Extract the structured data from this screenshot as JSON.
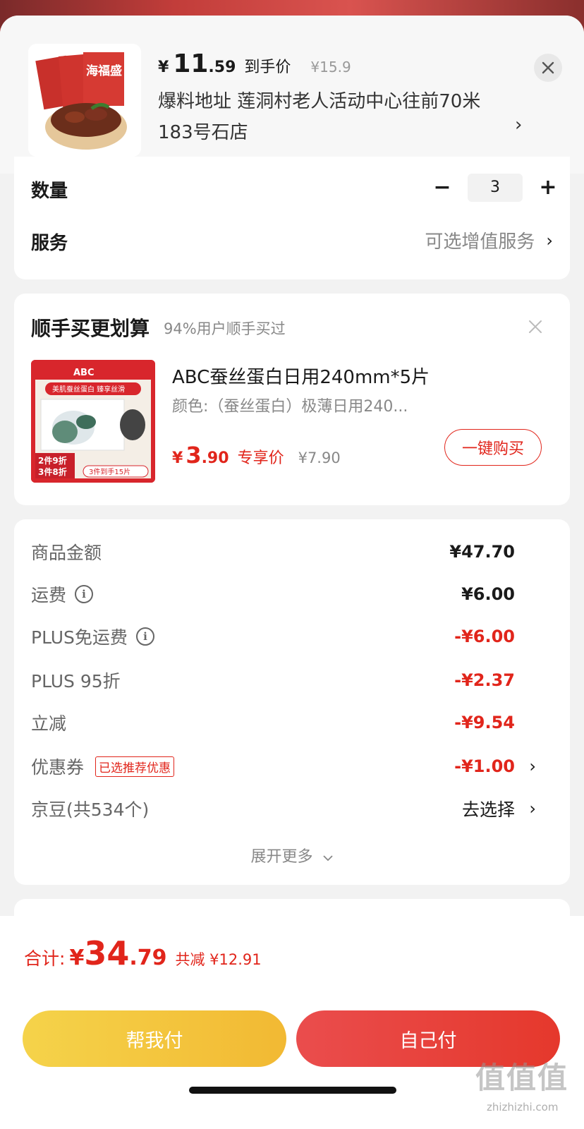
{
  "header": {
    "price_currency": "¥",
    "price_int": "11",
    "price_dec": ".59",
    "price_tag": "到手价",
    "original_price": "¥15.9",
    "address": "爆料地址  莲洞村老人活动中心往前70米183号石店",
    "address_chevron": "›",
    "close_icon": "close-icon",
    "product_image_text": "海福盛"
  },
  "quantity": {
    "label": "数量",
    "minus": "−",
    "value": "3",
    "plus": "+"
  },
  "service": {
    "label": "服务",
    "value": "可选增值服务",
    "chevron": "›"
  },
  "upsell": {
    "title": "顺手买更划算",
    "subtitle": "94%用户顺手买过",
    "item": {
      "name": "ABC蚕丝蛋白日用240mm*5片",
      "color": "颜色:（蚕丝蛋白）极薄日用240...",
      "price_currency": "¥",
      "price_int": "3",
      "price_dec": ".90",
      "price_tag": "专享价",
      "original_price": "¥7.90",
      "buy_label": "一键购买",
      "image_brand": "ABC",
      "image_line1": "美肌蚕丝蛋白 臻享丝滑",
      "image_badge1": "2件9折",
      "image_badge2": "3件8折",
      "image_badge3": "3件到手15片"
    }
  },
  "summary": {
    "rows": [
      {
        "label": "商品金额",
        "value": "¥47.70"
      },
      {
        "label": "运费",
        "value": "¥6.00"
      },
      {
        "label": "PLUS免运费",
        "value": "-¥6.00"
      },
      {
        "label": "PLUS 95折",
        "value": "-¥2.37"
      },
      {
        "label": "立减",
        "value": "-¥9.54"
      },
      {
        "label": "优惠券",
        "tag": "已选推荐优惠",
        "value": "-¥1.00"
      },
      {
        "label": "京豆(共534个)",
        "value": "去选择"
      }
    ],
    "expand_label": "展开更多",
    "expand_icon": "chevron-down-icon"
  },
  "footer": {
    "total_label": "合计:",
    "total_currency": "¥",
    "total_int": "34",
    "total_dec": ".79",
    "saved": "共减 ¥12.91",
    "help_pay": "帮我付",
    "self_pay": "自己付"
  },
  "watermark": {
    "text": "值值值",
    "url": "zhizhizhi.com"
  },
  "colors": {
    "accent_red": "#e1251b",
    "yellow_button": "#f2b933",
    "red_button": "#e5382c"
  }
}
